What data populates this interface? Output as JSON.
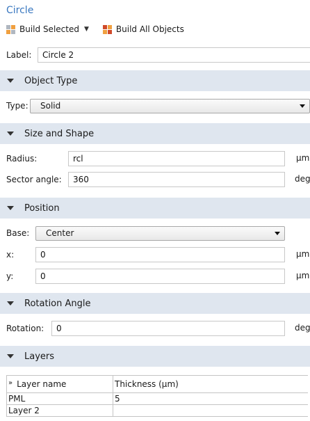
{
  "header": {
    "title": "Circle"
  },
  "toolbar": {
    "build_selected": "Build Selected",
    "build_all": "Build All Objects"
  },
  "label_field": {
    "label": "Label:",
    "value": "Circle 2"
  },
  "object_type": {
    "section": "Object Type",
    "type_label": "Type:",
    "type_value": "Solid"
  },
  "size_shape": {
    "section": "Size and Shape",
    "radius_label": "Radius:",
    "radius_value": "rcl",
    "radius_unit": "µm",
    "sector_label": "Sector angle:",
    "sector_value": "360",
    "sector_unit": "deg"
  },
  "position": {
    "section": "Position",
    "base_label": "Base:",
    "base_value": "Center",
    "x_label": "x:",
    "x_value": "0",
    "x_unit": "µm",
    "y_label": "y:",
    "y_value": "0",
    "y_unit": "µm"
  },
  "rotation": {
    "section": "Rotation Angle",
    "rotation_label": "Rotation:",
    "rotation_value": "0",
    "rotation_unit": "deg"
  },
  "layers": {
    "section": "Layers",
    "header_icon": "»",
    "columns": [
      "Layer name",
      "Thickness (µm)"
    ],
    "rows": [
      [
        "PML",
        "5"
      ],
      [
        "Layer 2",
        ""
      ]
    ]
  },
  "icons": {
    "build_selected": "build-selected-icon",
    "build_all": "build-all-icon",
    "section_toggle": "triangle-down-icon",
    "dropdown": "chevron-down-icon"
  }
}
